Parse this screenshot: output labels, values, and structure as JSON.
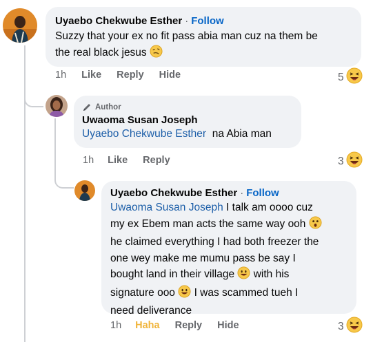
{
  "comment1": {
    "author": "Uyaebo Chekwube Esther",
    "separator": "·",
    "follow_label": "Follow",
    "text": "Suzzy that your ex no fit pass abia man cuz na them be the real black jesus",
    "text_line1": "Suzzy that your ex no fit pass abia man cuz na them be",
    "text_line2": "the real black jesus",
    "time": "1h",
    "like_label": "Like",
    "reply_label": "Reply",
    "hide_label": "Hide",
    "reaction_count": "5",
    "reaction_icon": "haha-emoji-icon"
  },
  "comment2": {
    "author_badge": "Author",
    "author": "Uwaoma Susan Joseph",
    "mention": "Uyaebo Chekwube Esther",
    "text": "na Abia man",
    "time": "1h",
    "like_label": "Like",
    "reply_label": "Reply",
    "reaction_count": "3",
    "reaction_icon": "haha-emoji-icon"
  },
  "comment3": {
    "author": "Uyaebo Chekwube Esther",
    "separator": "·",
    "follow_label": "Follow",
    "mention": "Uwaoma Susan Joseph",
    "line1_rest": "I talk am oooo cuz",
    "line2": "my ex Ebem man acts the same way ooh",
    "line3": "he claimed everything I had both freezer the",
    "line4": "one wey make me mumu pass be say I",
    "line5a": "bought land in their village",
    "line5b": "with his",
    "line6a": "signature ooo",
    "line6b": "I was scammed tueh I",
    "line7": "need deliverance",
    "time": "1h",
    "haha_label": "Haha",
    "reply_label": "Reply",
    "hide_label": "Hide",
    "reaction_count": "3",
    "reaction_icon": "haha-emoji-icon"
  },
  "colors": {
    "bubble": "#f0f2f5",
    "follow": "#0866c7",
    "mention": "#1c5ea8",
    "meta": "#65676b",
    "haha": "#f0b43a"
  }
}
